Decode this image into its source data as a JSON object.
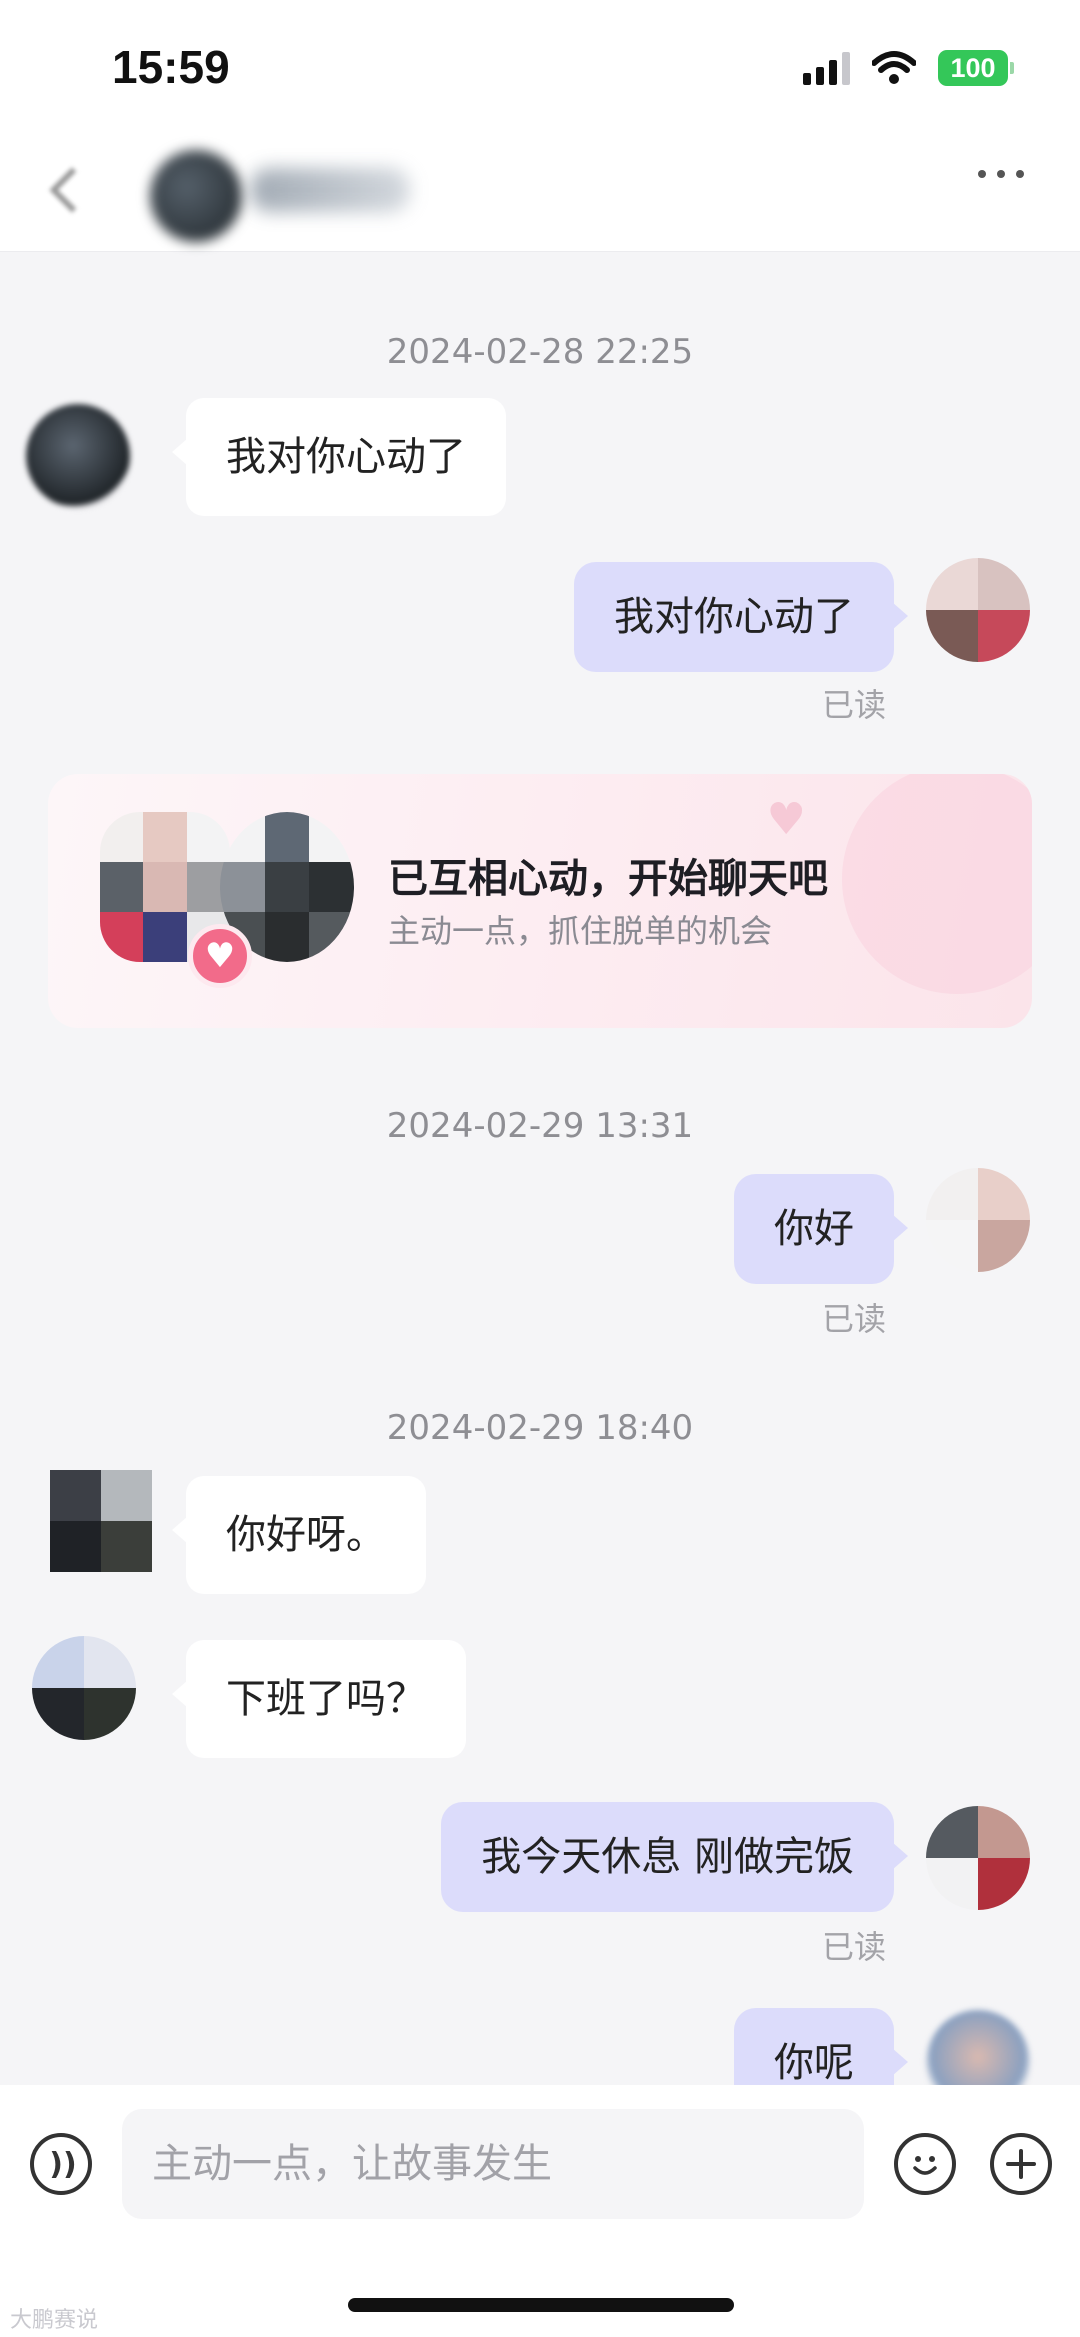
{
  "status_bar": {
    "time": "15:59",
    "battery": "100"
  },
  "messages": [
    {
      "type": "timestamp",
      "text": "2024-02-28 22:25"
    },
    {
      "type": "incoming",
      "text": "我对你心动了"
    },
    {
      "type": "outgoing",
      "text": "我对你心动了",
      "status": "已读"
    },
    {
      "type": "timestamp",
      "text": "2024-02-29 13:31"
    },
    {
      "type": "outgoing",
      "text": "你好",
      "status": "已读"
    },
    {
      "type": "timestamp",
      "text": "2024-02-29 18:40"
    },
    {
      "type": "incoming",
      "text": "你好呀。"
    },
    {
      "type": "incoming",
      "text": "下班了吗？"
    },
    {
      "type": "outgoing",
      "text": "我今天休息  刚做完饭",
      "status": "已读"
    },
    {
      "type": "outgoing",
      "text": "你呢"
    }
  ],
  "match_card": {
    "title": "已互相心动，开始聊天吧",
    "subtitle": "主动一点，抓住脱单的机会"
  },
  "input": {
    "placeholder": "主动一点，让故事发生"
  },
  "watermark": "大鹏赛说",
  "colors": {
    "outgoing_bubble": "#dcdcfb",
    "incoming_bubble": "#ffffff",
    "background": "#f5f5f7",
    "battery": "#34c759",
    "heart_badge": "#f26b8a"
  },
  "icons": [
    "back-icon",
    "more-icon",
    "voice-icon",
    "emoji-icon",
    "plus-icon",
    "heart-icon"
  ]
}
